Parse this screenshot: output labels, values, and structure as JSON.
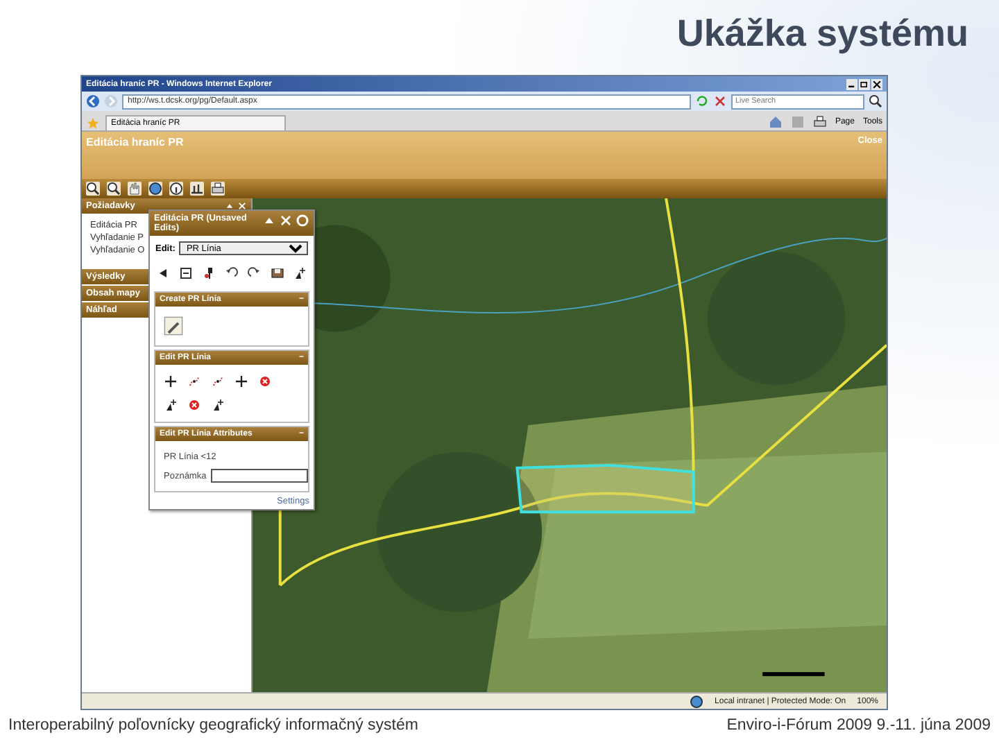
{
  "slide": {
    "title": "Ukážka systému"
  },
  "browser": {
    "title": "Editácia hraníc PR - Windows Internet Explorer",
    "address": "http://ws.t.dcsk.org/pg/Default.aspx",
    "search": {
      "placeholder": "Live Search"
    },
    "tabs": [
      {
        "label": "Editácia hraníc PR",
        "selected": true
      }
    ],
    "commands": [
      "Page",
      "Tools"
    ],
    "status_bar": {
      "zone": "Local intranet | Protected Mode: On",
      "zoom": "100%"
    }
  },
  "app": {
    "title": "Editácia hraníc PR",
    "close": "Close",
    "sidebar": {
      "sections": [
        {
          "label": "Požiadavky",
          "expanded": true,
          "items": [
            "Editácia PR",
            "Vyhľadanie P",
            "Vyhľadanie O"
          ]
        },
        {
          "label": "Výsledky",
          "expanded": false
        },
        {
          "label": "Obsah mapy",
          "expanded": false
        },
        {
          "label": "Náhľad",
          "expanded": false
        }
      ]
    },
    "edit_panel": {
      "title": "Editácia PR (Unsaved Edits)",
      "edit_label": "Edit:",
      "layer": "PR Línia",
      "sections": [
        {
          "title": "Create PR Línia",
          "toggle": "−",
          "kind": "create"
        },
        {
          "title": "Edit PR Línia",
          "toggle": "−",
          "kind": "edit"
        },
        {
          "title": "Edit PR Línia Attributes",
          "toggle": "−",
          "kind": "attributes",
          "feature": "PR Línia <12",
          "field_label": "Poznámka"
        }
      ],
      "settings": "Settings"
    }
  },
  "footer": {
    "left": "Interoperabilný poľovnícky geografický informačný systém",
    "right": "Enviro-i-Fórum 2009 9.-11. júna 2009"
  }
}
